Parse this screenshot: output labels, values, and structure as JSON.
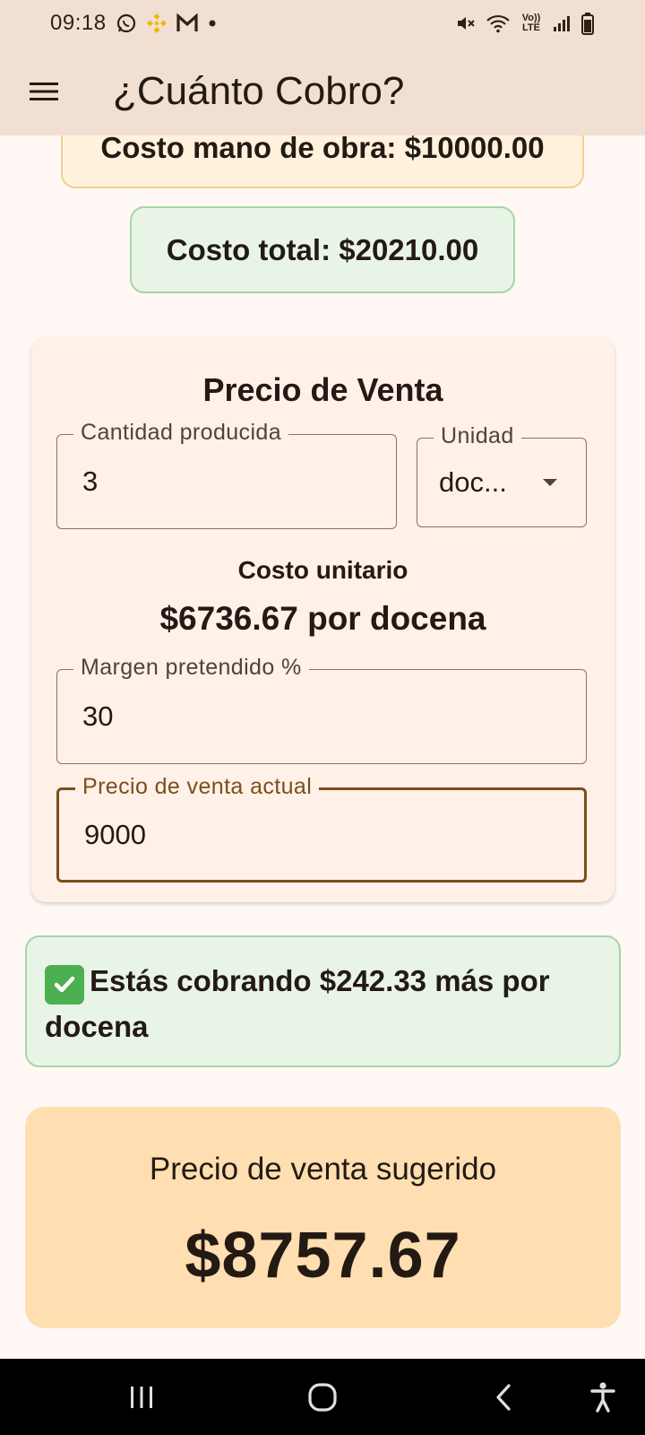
{
  "status_bar": {
    "time": "09:18",
    "icons_left": [
      "whatsapp-icon",
      "binance-icon",
      "gmail-icon",
      "dot-icon"
    ],
    "icons_right": [
      "mute-icon",
      "wifi-icon",
      "volte-icon",
      "signal-icon",
      "battery-icon"
    ],
    "volte_text": "Vo)) LTE"
  },
  "app_bar": {
    "title": "¿Cuánto Cobro?",
    "menu_icon": "hamburger-menu-icon"
  },
  "labor_cost": "Costo mano de obra: $10000.00",
  "total_cost": "Costo total: $20210.00",
  "price_card": {
    "title": "Precio de Venta",
    "quantity": {
      "label": "Cantidad producida",
      "value": "3"
    },
    "unit": {
      "label": "Unidad",
      "value": "doc..."
    },
    "unit_cost_label": "Costo unitario",
    "unit_cost_value": "$6736.67 por docena",
    "margin": {
      "label": "Margen pretendido %",
      "value": "30"
    },
    "current_price": {
      "label": "Precio de venta actual",
      "value": "9000"
    }
  },
  "result_message": "Estás cobrando $242.33 más por docena",
  "suggested": {
    "label": "Precio de venta sugerido",
    "value": "$8757.67"
  },
  "nav_bar": {
    "icons": [
      "recents-icon",
      "home-icon",
      "back-icon",
      "accessibility-icon"
    ]
  },
  "colors": {
    "app_bar_bg": "#f1e0d1",
    "page_bg": "#fff8f5",
    "labor_card_bg": "#fff1dc",
    "green_card_bg": "#e8f4e6",
    "price_card_bg": "#fff0e8",
    "suggested_bg": "#ffdfb1",
    "focus_border": "#7a4f1b"
  }
}
